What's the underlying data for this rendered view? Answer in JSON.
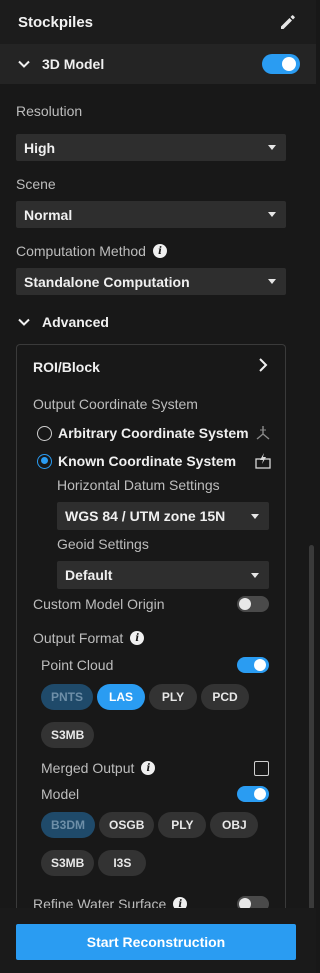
{
  "header": {
    "title": "Stockpiles",
    "edit_icon": "pencil-icon"
  },
  "section": {
    "label": "3D Model",
    "toggle_on": true
  },
  "resolution": {
    "label": "Resolution",
    "value": "High"
  },
  "scene": {
    "label": "Scene",
    "value": "Normal"
  },
  "computation": {
    "label": "Computation Method",
    "value": "Standalone Computation"
  },
  "advanced": {
    "label": "Advanced",
    "roi_label": "ROI/Block",
    "output_cs_label": "Output Coordinate System",
    "options": [
      {
        "label": "Arbitrary Coordinate System",
        "checked": false
      },
      {
        "label": "Known Coordinate System",
        "checked": true
      }
    ],
    "horizontal_datum_label": "Horizontal Datum Settings",
    "horizontal_datum_value": "WGS 84 / UTM zone 15N",
    "geoid_label": "Geoid Settings",
    "geoid_value": "Default",
    "custom_origin_label": "Custom Model Origin",
    "custom_origin_on": false,
    "output_format_label": "Output Format",
    "point_cloud_label": "Point Cloud",
    "point_cloud_on": true,
    "point_cloud_formats": [
      {
        "label": "PNTS",
        "state": "disabled"
      },
      {
        "label": "LAS",
        "state": "selected"
      },
      {
        "label": "PLY",
        "state": "normal"
      },
      {
        "label": "PCD",
        "state": "normal"
      },
      {
        "label": "S3MB",
        "state": "normal"
      }
    ],
    "merged_output_label": "Merged Output",
    "merged_output_checked": false,
    "model_label": "Model",
    "model_on": true,
    "model_formats": [
      {
        "label": "B3DM",
        "state": "disabled"
      },
      {
        "label": "OSGB",
        "state": "normal"
      },
      {
        "label": "PLY",
        "state": "normal"
      },
      {
        "label": "OBJ",
        "state": "normal"
      },
      {
        "label": "S3MB",
        "state": "normal"
      },
      {
        "label": "I3S",
        "state": "normal"
      }
    ],
    "refine_water_label": "Refine Water Surface",
    "refine_water_on": false
  },
  "footer": {
    "start_label": "Start Reconstruction"
  },
  "colors": {
    "accent": "#2a9cf2",
    "background": "#181818",
    "field": "#2e2e2e",
    "disabled_chip": "#1f4a6a"
  }
}
